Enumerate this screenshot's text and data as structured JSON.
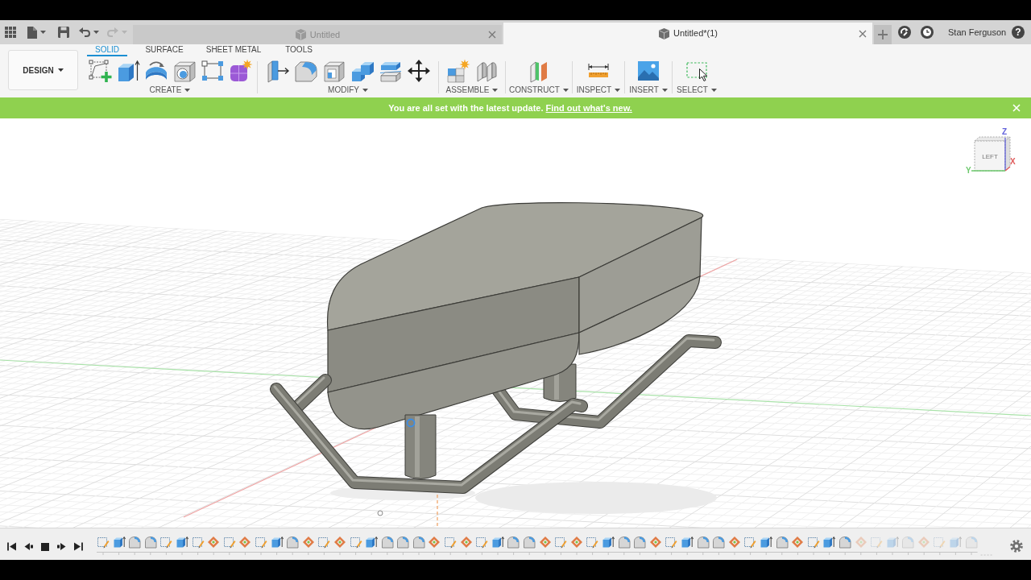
{
  "title_bar": {
    "undo": {
      "disabled": false
    },
    "redo": {
      "disabled": true
    },
    "tabs": [
      {
        "title": "Untitled",
        "selected": false
      },
      {
        "title": "Untitled*(1)",
        "selected": true
      }
    ],
    "user": "Stan Ferguson",
    "help": "?"
  },
  "toolbar": {
    "workspace": "DESIGN",
    "tabs": [
      {
        "label": "SOLID",
        "selected": true
      },
      {
        "label": "SURFACE",
        "selected": false
      },
      {
        "label": "SHEET METAL",
        "selected": false
      },
      {
        "label": "TOOLS",
        "selected": false
      }
    ],
    "groups": [
      {
        "label": "CREATE",
        "tools": [
          {
            "kind": "sketch"
          },
          {
            "kind": "extrude"
          },
          {
            "kind": "revolve"
          },
          {
            "kind": "hole"
          },
          {
            "kind": "pattern"
          },
          {
            "kind": "form"
          }
        ]
      },
      {
        "label": "MODIFY",
        "tools": [
          {
            "kind": "press_pull"
          },
          {
            "kind": "fillet"
          },
          {
            "kind": "shell"
          },
          {
            "kind": "combine"
          },
          {
            "kind": "split"
          },
          {
            "kind": "move"
          }
        ]
      },
      {
        "label": "ASSEMBLE",
        "tools": [
          {
            "kind": "component"
          },
          {
            "kind": "joint"
          }
        ]
      },
      {
        "label": "CONSTRUCT",
        "tools": [
          {
            "kind": "plane"
          }
        ]
      },
      {
        "label": "INSPECT",
        "tools": [
          {
            "kind": "measure"
          }
        ]
      },
      {
        "label": "INSERT",
        "tools": [
          {
            "kind": "image"
          }
        ]
      },
      {
        "label": "SELECT",
        "tools": [
          {
            "kind": "select"
          }
        ]
      }
    ]
  },
  "banner": {
    "message": "You are all set with the latest update.",
    "link": "Find out what's new."
  },
  "view_cube": {
    "face": "LEFT",
    "axes": [
      {
        "label": "Z",
        "color": "#6464dc"
      },
      {
        "label": "X",
        "color": "#e05a5a"
      },
      {
        "label": "Y",
        "color": "#6cc86c"
      }
    ]
  },
  "timeline": {
    "features": [
      {
        "kind": "sketch",
        "rolled_back": false
      },
      {
        "kind": "extrude",
        "rolled_back": false
      },
      {
        "kind": "fillet",
        "rolled_back": false
      },
      {
        "kind": "fillet",
        "rolled_back": false
      },
      {
        "kind": "sketch",
        "rolled_back": false
      },
      {
        "kind": "extrude",
        "rolled_back": false
      },
      {
        "kind": "sketch",
        "rolled_back": false
      },
      {
        "kind": "diamond",
        "rolled_back": false
      },
      {
        "kind": "sketch",
        "rolled_back": false
      },
      {
        "kind": "diamond",
        "rolled_back": false
      },
      {
        "kind": "sketch",
        "rolled_back": false
      },
      {
        "kind": "extrude",
        "rolled_back": false
      },
      {
        "kind": "fillet",
        "rolled_back": false
      },
      {
        "kind": "diamond",
        "rolled_back": false
      },
      {
        "kind": "sketch",
        "rolled_back": false
      },
      {
        "kind": "diamond",
        "rolled_back": false
      },
      {
        "kind": "sketch",
        "rolled_back": false
      },
      {
        "kind": "extrude",
        "rolled_back": false
      },
      {
        "kind": "fillet",
        "rolled_back": false
      },
      {
        "kind": "fillet",
        "rolled_back": false
      },
      {
        "kind": "fillet",
        "rolled_back": false
      },
      {
        "kind": "diamond",
        "rolled_back": false
      },
      {
        "kind": "sketch",
        "rolled_back": false
      },
      {
        "kind": "diamond",
        "rolled_back": false
      },
      {
        "kind": "sketch",
        "rolled_back": false
      },
      {
        "kind": "extrude",
        "rolled_back": false
      },
      {
        "kind": "fillet",
        "rolled_back": false
      },
      {
        "kind": "fillet",
        "rolled_back": false
      },
      {
        "kind": "diamond",
        "rolled_back": false
      },
      {
        "kind": "sketch",
        "rolled_back": false
      },
      {
        "kind": "diamond",
        "rolled_back": false
      },
      {
        "kind": "sketch",
        "rolled_back": false
      },
      {
        "kind": "extrude",
        "rolled_back": false
      },
      {
        "kind": "fillet",
        "rolled_back": false
      },
      {
        "kind": "fillet",
        "rolled_back": false
      },
      {
        "kind": "diamond",
        "rolled_back": false
      },
      {
        "kind": "sketch",
        "rolled_back": false
      },
      {
        "kind": "extrude",
        "rolled_back": false
      },
      {
        "kind": "fillet",
        "rolled_back": false
      },
      {
        "kind": "fillet",
        "rolled_back": false
      },
      {
        "kind": "diamond",
        "rolled_back": false
      },
      {
        "kind": "sketch",
        "rolled_back": false
      },
      {
        "kind": "extrude",
        "rolled_back": false
      },
      {
        "kind": "fillet",
        "rolled_back": false
      },
      {
        "kind": "diamond",
        "rolled_back": false
      },
      {
        "kind": "sketch",
        "rolled_back": false
      },
      {
        "kind": "extrude",
        "rolled_back": false
      },
      {
        "kind": "fillet",
        "rolled_back": false
      },
      {
        "kind": "diamond",
        "rolled_back": true
      },
      {
        "kind": "sketch",
        "rolled_back": true
      },
      {
        "kind": "extrude",
        "rolled_back": true
      },
      {
        "kind": "fillet",
        "rolled_back": true
      },
      {
        "kind": "diamond",
        "rolled_back": true
      },
      {
        "kind": "sketch",
        "rolled_back": true
      },
      {
        "kind": "extrude",
        "rolled_back": true
      },
      {
        "kind": "fillet",
        "rolled_back": true
      }
    ]
  }
}
